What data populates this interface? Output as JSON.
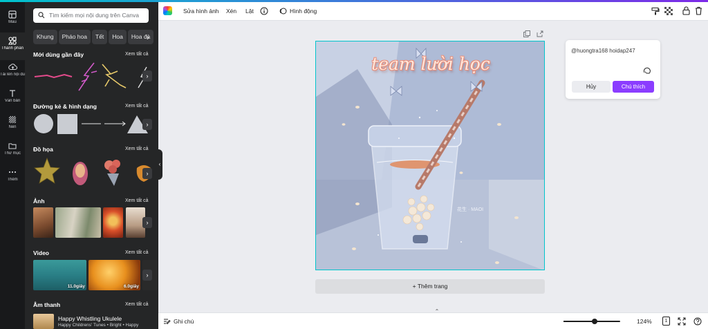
{
  "rail": [
    {
      "label": "Mẫu",
      "icon": "template-icon"
    },
    {
      "label": "Thành phần",
      "icon": "elements-icon",
      "active": true
    },
    {
      "label": "Tải lên nội dung t...",
      "icon": "upload-icon"
    },
    {
      "label": "Văn bản",
      "icon": "text-icon"
    },
    {
      "label": "Nền",
      "icon": "background-icon"
    },
    {
      "label": "Thư mục",
      "icon": "folder-icon"
    },
    {
      "label": "Thêm",
      "icon": "more-icon"
    }
  ],
  "panel": {
    "search_placeholder": "Tìm kiếm mọi nội dung trên Canva",
    "chips": [
      "Khung",
      "Pháo hoa",
      "Tết",
      "Hoa",
      "Hoa đà"
    ],
    "see_all": "Xem tất cả",
    "sections": {
      "recent": "Mới dùng gần đây",
      "lines": "Đường kẻ & hình dạng",
      "graphics": "Đồ họa",
      "photos": "Ảnh",
      "video": "Video",
      "audio": "Âm thanh"
    },
    "videos": [
      {
        "duration": "11.0giây"
      },
      {
        "duration": "6.0giây"
      }
    ],
    "audio": {
      "title": "Happy Whistling Ukulele",
      "meta": "Happy Childrens' Tunes • Bright • Happy"
    }
  },
  "toolbar": {
    "edit_image": "Sửa hình ảnh",
    "crop": "Xén",
    "flip": "Lật",
    "animate": "Hình động"
  },
  "canvas": {
    "title_text": "team lười học",
    "watermark": "花生 · MAOI",
    "add_page": "+ Thêm trang"
  },
  "comment": {
    "text": "@huongtra168 hoidap247",
    "cancel": "Hủy",
    "submit": "Chú thích"
  },
  "bottom": {
    "notes": "Ghi chú",
    "zoom": "124%",
    "zoom_level": 0.55,
    "page_count": "1"
  },
  "colors": {
    "accent": "#8b3dff",
    "selection": "#00c4cc",
    "sidebar": "#252627",
    "rail": "#18191b"
  }
}
